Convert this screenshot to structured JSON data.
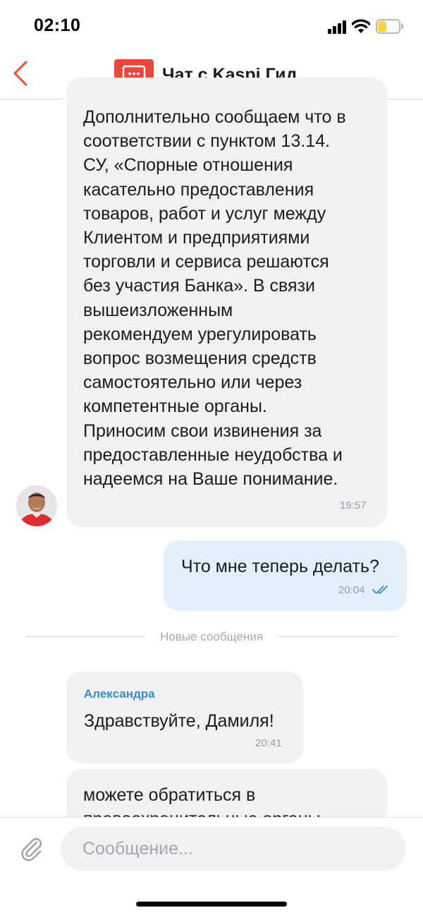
{
  "status_bar": {
    "time": "02:10"
  },
  "header": {
    "title": "Чат с Kaspi Гид"
  },
  "messages": {
    "m1": {
      "text": "Дополнительно сообщаем что в\nсоответствии с пунктом 13.14.\nСУ, «Спорные отношения\nкасательно предоставления\nтоваров, работ и услуг между\nКлиентом и предприятиями\nторговли и сервиса решаются\nбез участия Банка». В связи\nвышеизложенным\nрекомендуем урегулировать\nвопрос возмещения средств\nсамостоятельно или через\nкомпетентные органы.\nПриносим свои извинения за\nпредоставленные неудобства и\nнадеемся на Ваше понимание.",
      "time": "19:57"
    },
    "m2": {
      "text": "Что мне теперь делать?",
      "time": "20:04"
    },
    "m3": {
      "sender": "Александра",
      "text": "Здравствуйте, Дамиля!",
      "time": "20:41"
    },
    "m4": {
      "text": "можете обратиться в\nправоохранительные органы"
    }
  },
  "divider": {
    "label": "Новые сообщения"
  },
  "composer": {
    "placeholder": "Сообщение..."
  },
  "icons": {
    "back": "chevron-left-icon",
    "logo": "chat-bubble-icon",
    "attach": "paperclip-icon",
    "read": "double-check-icon"
  },
  "colors": {
    "accent": "#e8493b",
    "incoming_bubble": "#f0f1f3",
    "outgoing_bubble": "#e0eff9",
    "sender_name": "#3b8bc5",
    "read_check": "#3b8bc5"
  }
}
